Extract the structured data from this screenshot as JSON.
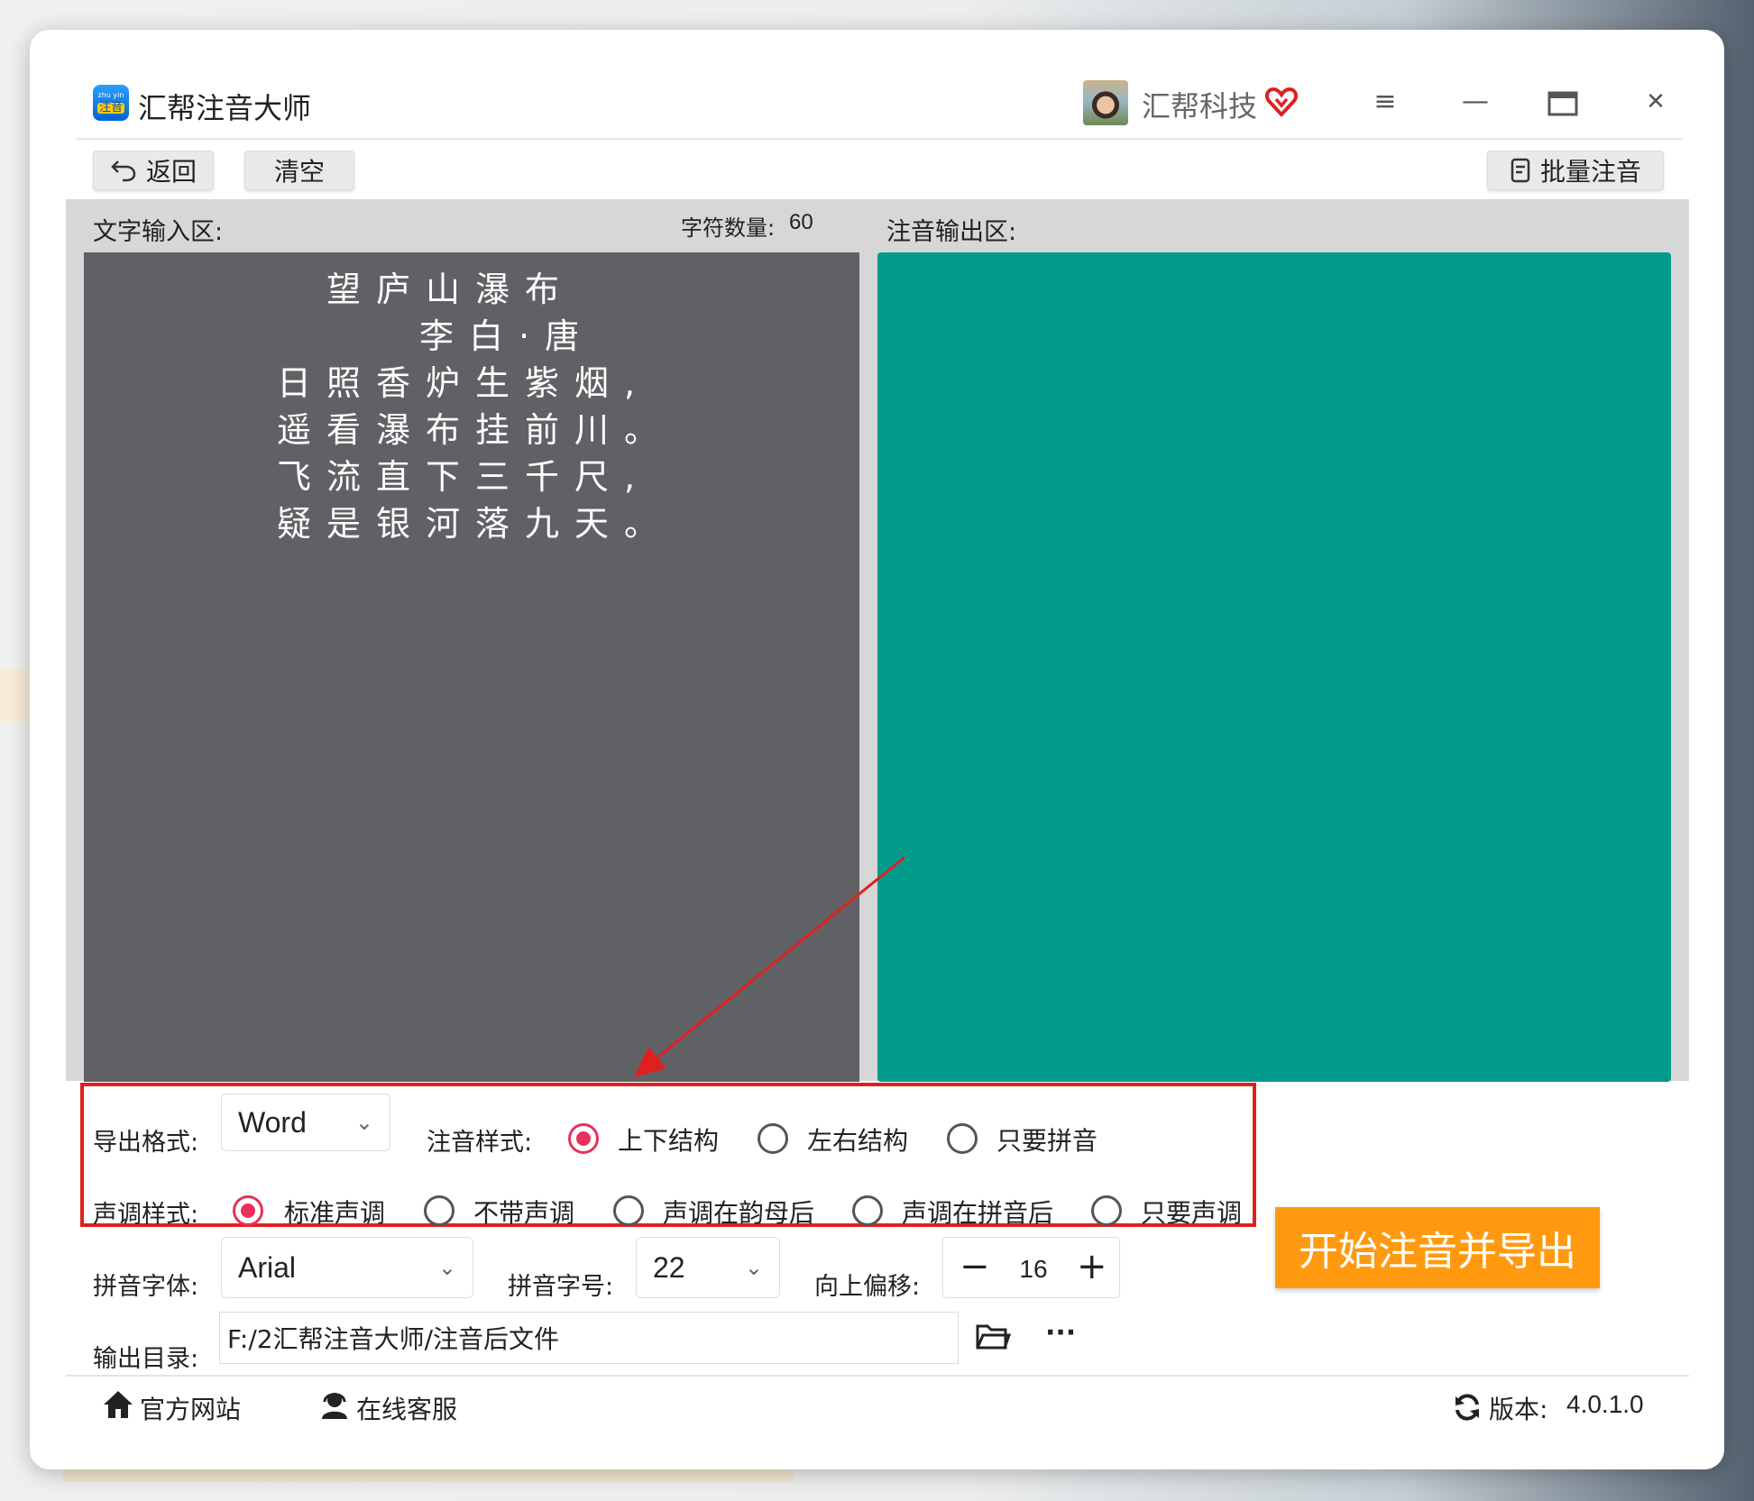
{
  "window": {
    "title": "汇帮注音大师",
    "app_icon_top": "zhu yin",
    "app_icon_main": "注音",
    "user_name": "汇帮科技"
  },
  "icons": {
    "vip": "heart-badge-icon",
    "menu": "hamburger-icon",
    "minimize": "minimize-icon",
    "maximize": "maximize-icon",
    "close": "close-icon",
    "back": "back-arrow-icon",
    "batch": "document-icon",
    "folder": "folder-open-icon",
    "more": "more-dots-icon",
    "home": "home-icon",
    "support": "headset-icon",
    "refresh": "refresh-icon"
  },
  "symbols": {
    "menu": "≡",
    "minimize": "—",
    "maximize": "▭",
    "close": "✕",
    "chevron": "⌄",
    "minus": "−",
    "plus": "+",
    "more": "···"
  },
  "toolbar": {
    "back_label": "返回",
    "clear_label": "清空",
    "batch_label": "批量注音"
  },
  "input_panel": {
    "label": "文字输入区:",
    "char_count_label": "字符数量:",
    "char_count": "60",
    "text_lines": [
      "望庐山瀑布",
      "李白·唐",
      "日照香炉生紫烟,",
      "遥看瀑布挂前川。",
      "飞流直下三千尺,",
      "疑是银河落九天。"
    ]
  },
  "output_panel": {
    "label": "注音输出区:"
  },
  "settings": {
    "export_format_label": "导出格式:",
    "export_format_value": "Word",
    "pinyin_style_label": "注音样式:",
    "pinyin_style_options": [
      "上下结构",
      "左右结构",
      "只要拼音"
    ],
    "pinyin_style_selected": 0,
    "tone_style_label": "声调样式:",
    "tone_style_options": [
      "标准声调",
      "不带声调",
      "声调在韵母后",
      "声调在拼音后",
      "只要声调"
    ],
    "tone_style_selected": 0,
    "font_label": "拼音字体:",
    "font_value": "Arial",
    "size_label": "拼音字号:",
    "size_value": "22",
    "offset_label": "向上偏移:",
    "offset_value": "16",
    "output_dir_label": "输出目录:",
    "output_dir_value": "F:/2汇帮注音大师/注音后文件"
  },
  "actions": {
    "start_label": "开始注音并导出"
  },
  "footer": {
    "website_label": "官方网站",
    "support_label": "在线客服",
    "version_label": "版本:",
    "version_value": "4.0.1.0"
  },
  "colors": {
    "accent_red": "#e8305a",
    "annotation_red": "#e02020",
    "output_teal": "#009b8b",
    "input_gray": "#606165",
    "start_orange": "#ff9a10"
  }
}
